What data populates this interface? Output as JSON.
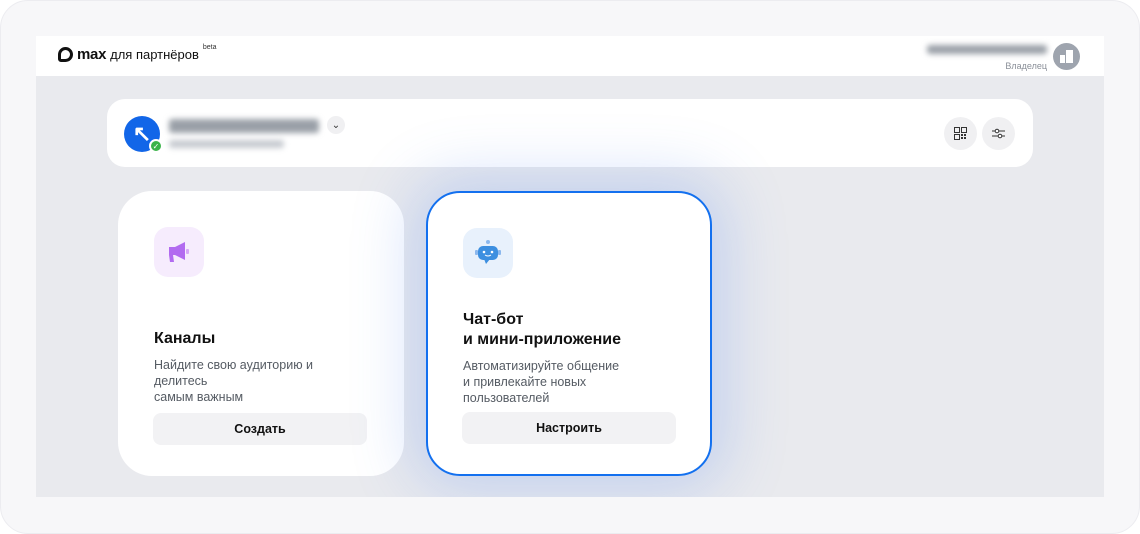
{
  "header": {
    "logo_max": "max",
    "logo_sub": "для партнёров",
    "beta": "beta",
    "user_role": "Владелец"
  },
  "cards": [
    {
      "title_lines": [
        "Каналы"
      ],
      "description_lines": [
        "Найдите свою аудиторию и делитесь",
        "самым важным"
      ],
      "button": "Создать",
      "icon": "megaphone-icon"
    },
    {
      "title_lines": [
        "Чат-бот",
        "и мини-приложение"
      ],
      "description_lines": [
        "Автоматизируйте общение",
        "и привлекайте новых пользователей"
      ],
      "button": "Настроить",
      "icon": "robot-icon"
    }
  ],
  "colors": {
    "accent": "#1370ef",
    "verified": "#3bb34a"
  }
}
